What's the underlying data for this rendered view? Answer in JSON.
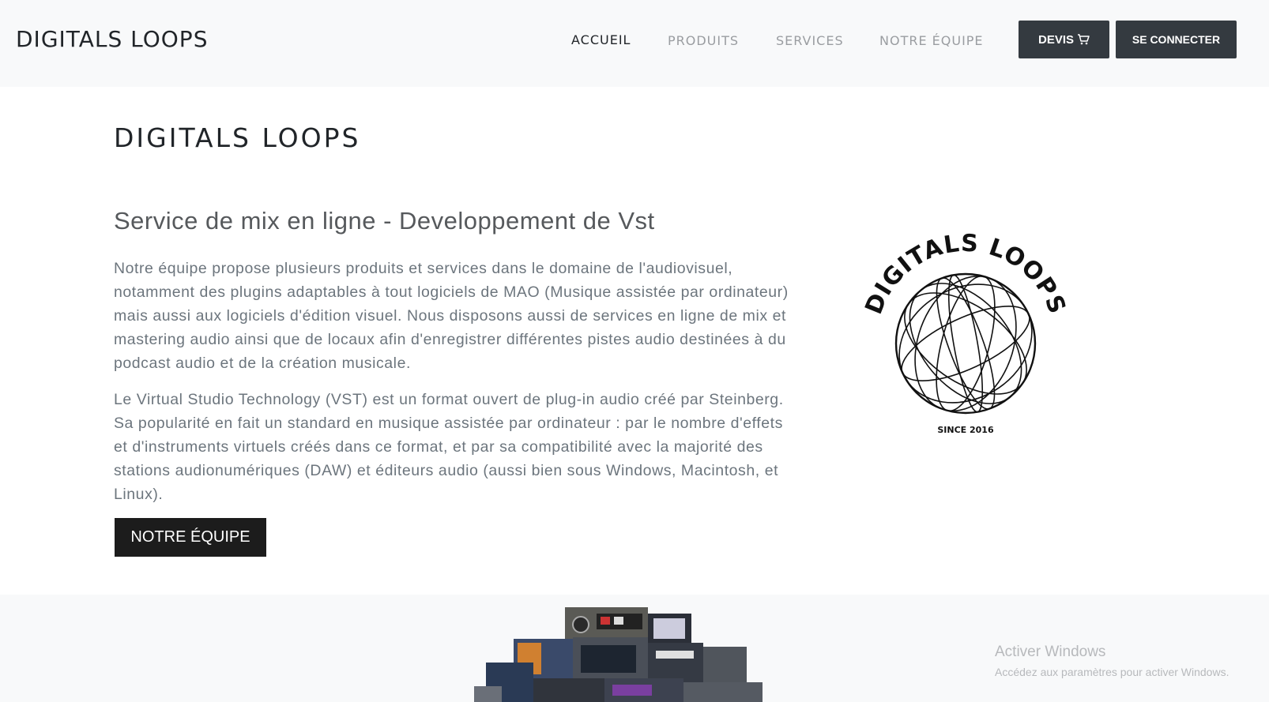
{
  "navbar": {
    "brand": "DIGITALS LOOPS",
    "links": [
      {
        "label": "ACCUEIL",
        "active": true
      },
      {
        "label": "PRODUITS",
        "active": false
      },
      {
        "label": "SERVICES",
        "active": false
      },
      {
        "label": "NOTRE ÉQUIPE",
        "active": false
      }
    ],
    "quote_button": "DEVIS",
    "quote_icon": "cart-icon",
    "login_button": "SE CONNECTER"
  },
  "main": {
    "title": "DIGITALS LOOPS",
    "subtitle": "Service de mix en ligne - Developpement de Vst",
    "paragraph1": "Notre équipe propose plusieurs produits et services dans le domaine de l'audiovisuel, notamment des plugins adaptables à tout logiciels de MAO (Musique assistée par ordinateur) mais aussi aux logiciels d'édition visuel. Nous disposons aussi de services en ligne de mix et mastering audio ainsi que de locaux afin d'enregistrer différentes pistes audio destinées à du podcast audio et de la création musicale.",
    "paragraph2": "Le Virtual Studio Technology (VST) est un format ouvert de plug-in audio créé par Steinberg. Sa popularité en fait un standard en musique assistée par ordinateur : par le nombre d'effets et d'instruments virtuels créés dans ce format, et par sa compatibilité avec la majorité des stations audionumériques (DAW) et éditeurs audio (aussi bien sous Windows, Macintosh, et Linux).",
    "team_button": "NOTRE ÉQUIPE"
  },
  "logo": {
    "text": "DIGITALS LOOPS",
    "since": "SINCE 2016"
  },
  "footer": {
    "plugins_image": "plugin-collage-image"
  },
  "windows_watermark": {
    "title": "Activer Windows",
    "subtitle": "Accédez aux paramètres pour activer Windows."
  },
  "colors": {
    "navbar_bg": "#f8f9fa",
    "button_dark": "#343a40",
    "text_dark": "#212529",
    "text_muted": "#6c757d"
  }
}
